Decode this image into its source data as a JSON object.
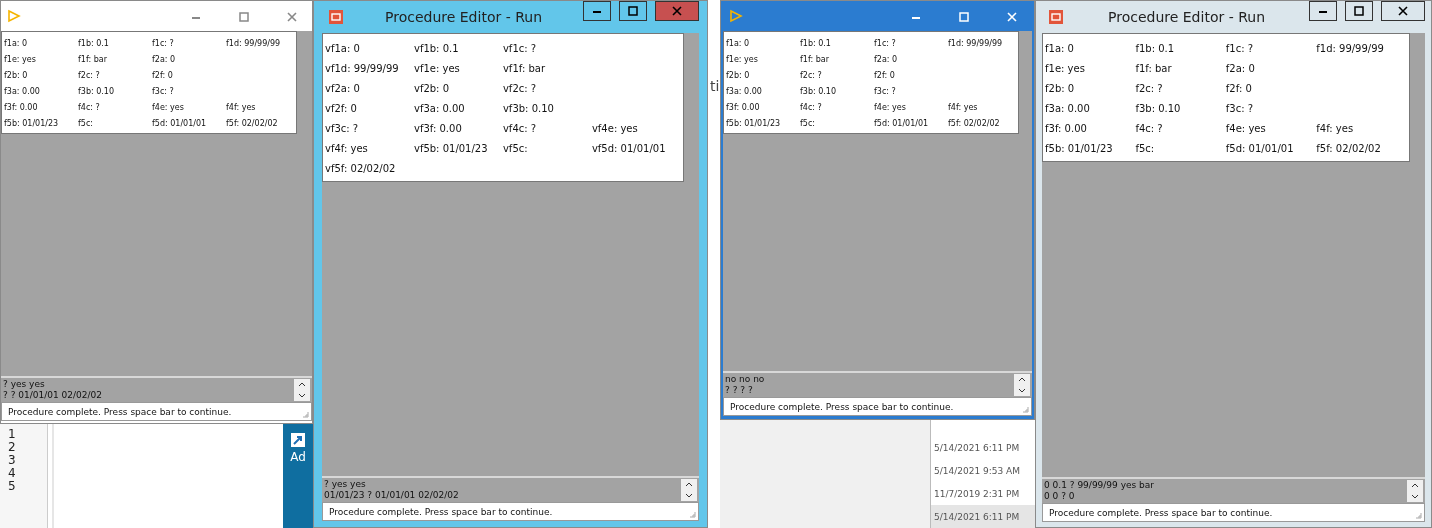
{
  "windows": [
    {
      "kind": "plain",
      "fields": [
        [
          "f1a: 0",
          "f1b: 0.1",
          "f1c: ?",
          "f1d: 99/99/99"
        ],
        [
          "f1e: yes",
          "f1f: bar",
          "f2a: 0"
        ],
        [
          "f2b: 0",
          "f2c: ?",
          "f2f: 0"
        ],
        [
          "f3a: 0.00",
          "f3b: 0.10",
          "f3c: ?"
        ],
        [
          "f3f: 0.00",
          "f4c: ?",
          "f4e: yes",
          "f4f: yes"
        ],
        [
          "f5b: 01/01/23",
          "f5c:",
          "f5d: 01/01/01",
          "f5f: 02/02/02"
        ]
      ],
      "output": [
        "? yes yes",
        "? ? 01/01/01 02/02/02"
      ],
      "status": "Procedure complete. Press space bar to continue.",
      "below": {
        "kind": "editor",
        "line_numbers": [
          "1",
          "2",
          "3",
          "4",
          "5"
        ],
        "icon_label": "Ad"
      }
    },
    {
      "kind": "classic",
      "title": "Procedure Editor - Run",
      "fields": [
        [
          "vf1a: 0",
          "vf1b: 0.1",
          "vf1c: ?"
        ],
        [
          "vf1d: 99/99/99",
          "vf1e: yes",
          "vf1f: bar"
        ],
        [
          "vf2a: 0",
          "vf2b: 0",
          "vf2c: ?"
        ],
        [
          "vf2f: 0",
          "vf3a: 0.00",
          "vf3b: 0.10"
        ],
        [
          "vf3c: ?",
          "vf3f: 0.00",
          "vf4c: ?",
          "vf4e: yes"
        ],
        [
          "vf4f: yes",
          "vf5b: 01/01/23",
          "vf5c:",
          "vf5d: 01/01/01"
        ],
        [
          "vf5f: 02/02/02"
        ]
      ],
      "output": [
        "? yes yes",
        "01/01/23 ? 01/01/01 02/02/02"
      ],
      "status": "Procedure complete. Press space bar to continue.",
      "gap_text": "ti"
    },
    {
      "kind": "blue",
      "fields": [
        [
          "f1a: 0",
          "f1b: 0.1",
          "f1c: ?",
          "f1d: 99/99/99"
        ],
        [
          "f1e: yes",
          "f1f: bar",
          "f2a: 0"
        ],
        [
          "f2b: 0",
          "f2c: ?",
          "f2f: 0"
        ],
        [
          "f3a: 0.00",
          "f3b: 0.10",
          "f3c: ?"
        ],
        [
          "f3f: 0.00",
          "f4c: ?",
          "f4e: yes",
          "f4f: yes"
        ],
        [
          "f5b: 01/01/23",
          "f5c:",
          "f5d: 01/01/01",
          "f5f: 02/02/02"
        ]
      ],
      "output": [
        "no no no",
        "? ? ? ?"
      ],
      "status": "Procedure complete. Press space bar to continue.",
      "below": {
        "kind": "dates",
        "dates": [
          {
            "text": "5/14/2021 6:11 PM",
            "selected": false
          },
          {
            "text": "5/14/2021 9:53 AM",
            "selected": false
          },
          {
            "text": "11/7/2019 2:31 PM",
            "selected": false
          },
          {
            "text": "5/14/2021 6:11 PM",
            "selected": true
          }
        ]
      }
    },
    {
      "kind": "light",
      "title": "Procedure Editor - Run",
      "fields": [
        [
          "f1a: 0",
          "f1b: 0.1",
          "f1c: ?",
          "f1d: 99/99/99"
        ],
        [
          "f1e: yes",
          "f1f: bar",
          "f2a: 0"
        ],
        [
          "f2b: 0",
          "f2c: ?",
          "f2f: 0"
        ],
        [
          "f3a: 0.00",
          "f3b: 0.10",
          "f3c: ?"
        ],
        [
          "f3f: 0.00",
          "f4c: ?",
          "f4e: yes",
          "f4f: yes"
        ],
        [
          "f5b: 01/01/23",
          "f5c:",
          "f5d: 01/01/01",
          "f5f: 02/02/02"
        ]
      ],
      "output": [
        "0 0.1 ? 99/99/99 yes bar",
        "0 0 ? 0"
      ],
      "status": "Procedure complete. Press space bar to continue."
    }
  ]
}
